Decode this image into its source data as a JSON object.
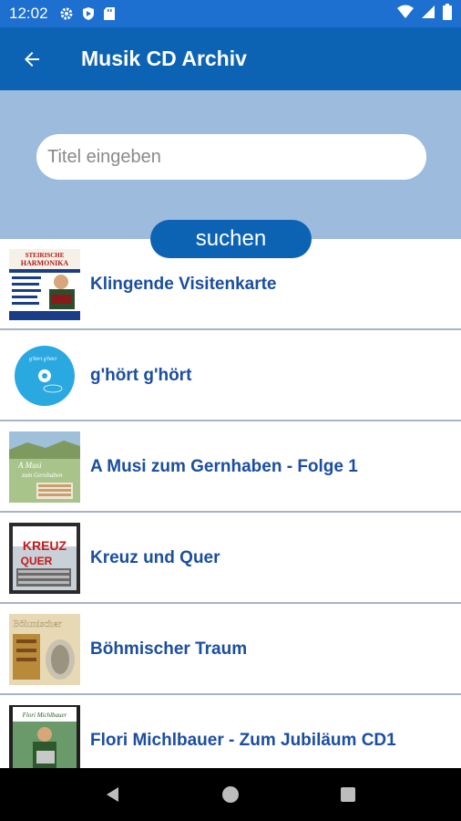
{
  "status_bar": {
    "time": "12:02",
    "left_icons": [
      "gear-icon",
      "shield-icon",
      "sd-card-icon"
    ],
    "right_icons": [
      "wifi-icon",
      "signal-icon",
      "battery-icon"
    ]
  },
  "app_bar": {
    "title": "Musik CD Archiv",
    "back_icon": "back-arrow-icon"
  },
  "search": {
    "placeholder": "Titel eingeben",
    "value": "",
    "button_label": "suchen"
  },
  "cd_list": [
    {
      "title": "Klingende Visitenkarte",
      "cover_text": "STEIRISCHE HARMONIKA"
    },
    {
      "title": "g'hört g'hört",
      "cover_text": "g'hört g'hört"
    },
    {
      "title": "A Musi zum Gernhaben - Folge 1",
      "cover_text": "A Musi zum Gernhaben"
    },
    {
      "title": "Kreuz und Quer",
      "cover_text": "KREUZ QUER"
    },
    {
      "title": "Böhmischer Traum",
      "cover_text": "Böhmischer"
    },
    {
      "title": "Flori Michlbauer - Zum Jubiläum CD1",
      "cover_text": "Flori Michlbauer"
    }
  ],
  "colors": {
    "status_bar": "#1d6fd0",
    "app_bar": "#0d63b3",
    "search_panel": "#9dbcdd",
    "item_title": "#1b4ea0",
    "divider": "#a7b3c8"
  },
  "nav_bar": {
    "icons": [
      "back-triangle-icon",
      "home-circle-icon",
      "recents-square-icon"
    ]
  }
}
